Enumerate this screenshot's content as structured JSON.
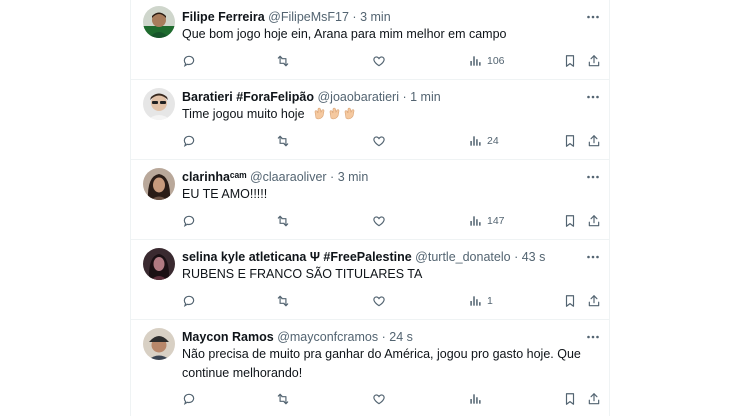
{
  "tweets": [
    {
      "name": "Filipe Ferreira",
      "handle": "@FilipeMsF17",
      "sep": "·",
      "time": "3 min",
      "text": "Que bom jogo hoje ein, Arana para mim melhor em campo",
      "views": "106",
      "avatar": "green-shirt-man"
    },
    {
      "name": "Baratieri #ForaFelipão",
      "handle": "@joaobaratieri",
      "sep": "·",
      "time": "1 min",
      "text": "Time jogou muito hoje",
      "emoji": "👏👏👏",
      "views": "24",
      "avatar": "man-with-sunglasses"
    },
    {
      "name": "clarinhaᶜᵃᵐ",
      "handle": "@claaraoliver",
      "sep": "·",
      "time": "3 min",
      "text": "EU TE AMO!!!!!",
      "views": "147",
      "avatar": "woman-portrait"
    },
    {
      "name": "selina kyle atleticana Ψ #FreePalestine",
      "handle": "@turtle_donatelo",
      "sep": "·",
      "time": "43 s",
      "text": "RUBENS E FRANCO SÃO TITULARES TA",
      "views": "1",
      "avatar": "dark-portrait"
    },
    {
      "name": "Maycon Ramos",
      "handle": "@mayconfcramos",
      "sep": "·",
      "time": "24 s",
      "text_lines": [
        "Não precisa de muito pra ganhar do América, jogou pro gasto hoje. Que",
        "continue melhorando!"
      ],
      "views": "",
      "avatar": "man-with-cap"
    }
  ],
  "icons": {
    "more": "more-horizontal-icon",
    "reply": "reply-icon",
    "retweet": "retweet-icon",
    "like": "like-icon",
    "views": "views-icon",
    "bookmark": "bookmark-icon",
    "share": "share-icon"
  },
  "colors": {
    "text": "#0f1419",
    "secondary": "#536471",
    "divider": "#eff3f4",
    "background": "#ffffff"
  }
}
